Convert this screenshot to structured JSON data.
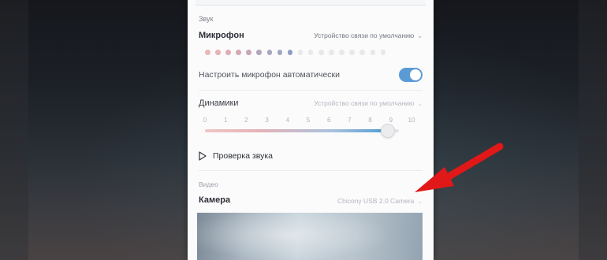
{
  "sound": {
    "section_title": "Звук",
    "microphone": {
      "label": "Микрофон",
      "device": "Устройство связи по умолчанию",
      "level_dots_total": 18,
      "level_dots_active": 9,
      "level_dot_colors": [
        "#e8b9b8",
        "#e6b3b6",
        "#dfaeb4",
        "#d5a9b3",
        "#c6a8b6",
        "#b4a6ba",
        "#a9a7bf",
        "#a1a8c3",
        "#8d9fc6"
      ],
      "level_dot_inactive_color": "#e7e8ea"
    },
    "auto_adjust": {
      "label": "Настроить микрофон автоматически",
      "enabled": true,
      "accent_color": "#5b9bd5"
    },
    "speakers": {
      "label": "Динамики",
      "device": "Устройство связи по умолчанию",
      "scale": [
        "0",
        "1",
        "2",
        "3",
        "4",
        "5",
        "6",
        "7",
        "8",
        "9",
        "10"
      ],
      "volume": 9.4
    },
    "test_sound": {
      "label": "Проверка звука",
      "icon": "play-icon"
    }
  },
  "video": {
    "section_title": "Видео",
    "camera": {
      "label": "Камера",
      "device": "Chicony USB 2.0 Camera"
    }
  },
  "annotation": {
    "arrow_color": "#e11818",
    "icon": "red-arrow-icon"
  }
}
